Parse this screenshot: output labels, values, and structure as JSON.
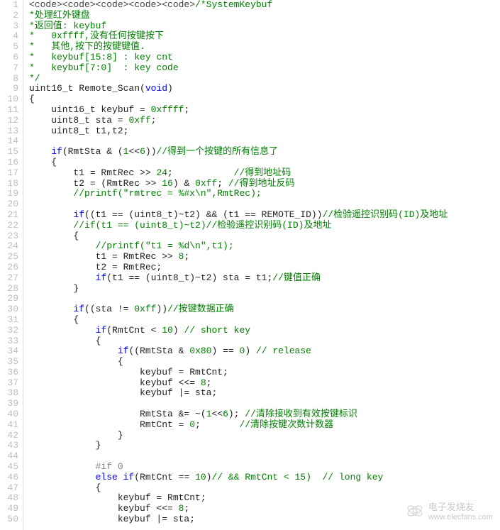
{
  "watermark": {
    "cn": "电子发烧友",
    "url": "www.elecfans.com"
  },
  "lines": [
    {
      "n": 1,
      "type": "mixed",
      "segments": [
        {
          "cls": "c-tag",
          "text": "<code><code><code><code><code>"
        },
        {
          "cls": "c-comment",
          "text": "/*SystemKeybuf"
        }
      ]
    },
    {
      "n": 2,
      "type": "comment",
      "text": "*处理红外键盘"
    },
    {
      "n": 3,
      "type": "comment",
      "text": "*返回值: keybuf"
    },
    {
      "n": 4,
      "type": "comment",
      "text": "*   0xffff,没有任何按键按下"
    },
    {
      "n": 5,
      "type": "comment",
      "text": "*   其他,按下的按键键值."
    },
    {
      "n": 6,
      "type": "comment",
      "text": "*   keybuf[15:8] : key cnt"
    },
    {
      "n": 7,
      "type": "comment",
      "text": "*   keybuf[7:0]  : key code"
    },
    {
      "n": 8,
      "type": "comment",
      "text": "*/"
    },
    {
      "n": 9,
      "type": "code",
      "segments": [
        {
          "cls": "c-default",
          "text": "uint16_t Remote_Scan("
        },
        {
          "cls": "c-keyword",
          "text": "void"
        },
        {
          "cls": "c-default",
          "text": ")"
        }
      ]
    },
    {
      "n": 10,
      "type": "code",
      "segments": [
        {
          "cls": "c-default",
          "text": "{"
        }
      ]
    },
    {
      "n": 11,
      "type": "code",
      "segments": [
        {
          "cls": "c-default",
          "text": "    uint16_t keybuf = "
        },
        {
          "cls": "c-number",
          "text": "0xffff"
        },
        {
          "cls": "c-default",
          "text": ";"
        }
      ]
    },
    {
      "n": 12,
      "type": "code",
      "segments": [
        {
          "cls": "c-default",
          "text": "    uint8_t sta = "
        },
        {
          "cls": "c-number",
          "text": "0xff"
        },
        {
          "cls": "c-default",
          "text": ";"
        }
      ]
    },
    {
      "n": 13,
      "type": "code",
      "segments": [
        {
          "cls": "c-default",
          "text": "    uint8_t t1,t2;"
        }
      ]
    },
    {
      "n": 14,
      "type": "blank"
    },
    {
      "n": 15,
      "type": "code",
      "segments": [
        {
          "cls": "c-default",
          "text": "    "
        },
        {
          "cls": "c-keyword",
          "text": "if"
        },
        {
          "cls": "c-default",
          "text": "(RmtSta & ("
        },
        {
          "cls": "c-number",
          "text": "1"
        },
        {
          "cls": "c-default",
          "text": "<<"
        },
        {
          "cls": "c-number",
          "text": "6"
        },
        {
          "cls": "c-default",
          "text": "))"
        },
        {
          "cls": "c-comment",
          "text": "//得到一个按键的所有信息了"
        }
      ]
    },
    {
      "n": 16,
      "type": "code",
      "segments": [
        {
          "cls": "c-default",
          "text": "    {"
        }
      ]
    },
    {
      "n": 17,
      "type": "code",
      "segments": [
        {
          "cls": "c-default",
          "text": "        t1 = RmtRec >> "
        },
        {
          "cls": "c-number",
          "text": "24"
        },
        {
          "cls": "c-default",
          "text": ";           "
        },
        {
          "cls": "c-comment",
          "text": "//得到地址码"
        }
      ]
    },
    {
      "n": 18,
      "type": "code",
      "segments": [
        {
          "cls": "c-default",
          "text": "        t2 = (RmtRec >> "
        },
        {
          "cls": "c-number",
          "text": "16"
        },
        {
          "cls": "c-default",
          "text": ") & "
        },
        {
          "cls": "c-number",
          "text": "0xff"
        },
        {
          "cls": "c-default",
          "text": "; "
        },
        {
          "cls": "c-comment",
          "text": "//得到地址反码"
        }
      ]
    },
    {
      "n": 19,
      "type": "code",
      "segments": [
        {
          "cls": "c-default",
          "text": "        "
        },
        {
          "cls": "c-comment",
          "text": "//printf(\"rmtrec = %#x\\n\",RmtRec);"
        }
      ]
    },
    {
      "n": 20,
      "type": "blank"
    },
    {
      "n": 21,
      "type": "code",
      "segments": [
        {
          "cls": "c-default",
          "text": "        "
        },
        {
          "cls": "c-keyword",
          "text": "if"
        },
        {
          "cls": "c-default",
          "text": "((t1 == (uint8_t)~t2) && (t1 == REMOTE_ID))"
        },
        {
          "cls": "c-comment",
          "text": "//检验遥控识别码(ID)及地址"
        }
      ]
    },
    {
      "n": 22,
      "type": "code",
      "segments": [
        {
          "cls": "c-default",
          "text": "        "
        },
        {
          "cls": "c-comment",
          "text": "//if(t1 == (uint8_t)~t2)//检验遥控识别码(ID)及地址"
        }
      ]
    },
    {
      "n": 23,
      "type": "code",
      "segments": [
        {
          "cls": "c-default",
          "text": "        {"
        }
      ]
    },
    {
      "n": 24,
      "type": "code",
      "segments": [
        {
          "cls": "c-default",
          "text": "            "
        },
        {
          "cls": "c-comment",
          "text": "//printf(\"t1 = %d\\n\",t1);"
        }
      ]
    },
    {
      "n": 25,
      "type": "code",
      "segments": [
        {
          "cls": "c-default",
          "text": "            t1 = RmtRec >> "
        },
        {
          "cls": "c-number",
          "text": "8"
        },
        {
          "cls": "c-default",
          "text": ";"
        }
      ]
    },
    {
      "n": 26,
      "type": "code",
      "segments": [
        {
          "cls": "c-default",
          "text": "            t2 = RmtRec;"
        }
      ]
    },
    {
      "n": 27,
      "type": "code",
      "segments": [
        {
          "cls": "c-default",
          "text": "            "
        },
        {
          "cls": "c-keyword",
          "text": "if"
        },
        {
          "cls": "c-default",
          "text": "(t1 == (uint8_t)~t2) sta = t1;"
        },
        {
          "cls": "c-comment",
          "text": "//键值正确"
        }
      ]
    },
    {
      "n": 28,
      "type": "code",
      "segments": [
        {
          "cls": "c-default",
          "text": "        }"
        }
      ]
    },
    {
      "n": 29,
      "type": "blank"
    },
    {
      "n": 30,
      "type": "code",
      "segments": [
        {
          "cls": "c-default",
          "text": "        "
        },
        {
          "cls": "c-keyword",
          "text": "if"
        },
        {
          "cls": "c-default",
          "text": "((sta != "
        },
        {
          "cls": "c-number",
          "text": "0xff"
        },
        {
          "cls": "c-default",
          "text": "))"
        },
        {
          "cls": "c-comment",
          "text": "//按键数据正确"
        }
      ]
    },
    {
      "n": 31,
      "type": "code",
      "segments": [
        {
          "cls": "c-default",
          "text": "        {"
        }
      ]
    },
    {
      "n": 32,
      "type": "code",
      "segments": [
        {
          "cls": "c-default",
          "text": "            "
        },
        {
          "cls": "c-keyword",
          "text": "if"
        },
        {
          "cls": "c-default",
          "text": "(RmtCnt < "
        },
        {
          "cls": "c-number",
          "text": "10"
        },
        {
          "cls": "c-default",
          "text": ") "
        },
        {
          "cls": "c-comment",
          "text": "// short key"
        }
      ]
    },
    {
      "n": 33,
      "type": "code",
      "segments": [
        {
          "cls": "c-default",
          "text": "            {"
        }
      ]
    },
    {
      "n": 34,
      "type": "code",
      "segments": [
        {
          "cls": "c-default",
          "text": "                "
        },
        {
          "cls": "c-keyword",
          "text": "if"
        },
        {
          "cls": "c-default",
          "text": "((RmtSta & "
        },
        {
          "cls": "c-number",
          "text": "0x80"
        },
        {
          "cls": "c-default",
          "text": ") == "
        },
        {
          "cls": "c-number",
          "text": "0"
        },
        {
          "cls": "c-default",
          "text": ") "
        },
        {
          "cls": "c-comment",
          "text": "// release"
        }
      ]
    },
    {
      "n": 35,
      "type": "code",
      "segments": [
        {
          "cls": "c-default",
          "text": "                {"
        }
      ]
    },
    {
      "n": 36,
      "type": "code",
      "segments": [
        {
          "cls": "c-default",
          "text": "                    keybuf = RmtCnt;"
        }
      ]
    },
    {
      "n": 37,
      "type": "code",
      "segments": [
        {
          "cls": "c-default",
          "text": "                    keybuf <<= "
        },
        {
          "cls": "c-number",
          "text": "8"
        },
        {
          "cls": "c-default",
          "text": ";"
        }
      ]
    },
    {
      "n": 38,
      "type": "code",
      "segments": [
        {
          "cls": "c-default",
          "text": "                    keybuf |= sta;"
        }
      ]
    },
    {
      "n": 39,
      "type": "blank"
    },
    {
      "n": 40,
      "type": "code",
      "segments": [
        {
          "cls": "c-default",
          "text": "                    RmtSta &= ~("
        },
        {
          "cls": "c-number",
          "text": "1"
        },
        {
          "cls": "c-default",
          "text": "<<"
        },
        {
          "cls": "c-number",
          "text": "6"
        },
        {
          "cls": "c-default",
          "text": "); "
        },
        {
          "cls": "c-comment",
          "text": "//清除接收到有效按键标识"
        }
      ]
    },
    {
      "n": 41,
      "type": "code",
      "segments": [
        {
          "cls": "c-default",
          "text": "                    RmtCnt = "
        },
        {
          "cls": "c-number",
          "text": "0"
        },
        {
          "cls": "c-default",
          "text": ";       "
        },
        {
          "cls": "c-comment",
          "text": "//清除按键次数计数器"
        }
      ]
    },
    {
      "n": 42,
      "type": "code",
      "segments": [
        {
          "cls": "c-default",
          "text": "                }"
        }
      ]
    },
    {
      "n": 43,
      "type": "code",
      "segments": [
        {
          "cls": "c-default",
          "text": "            }"
        }
      ]
    },
    {
      "n": 44,
      "type": "blank"
    },
    {
      "n": 45,
      "type": "code",
      "segments": [
        {
          "cls": "c-default",
          "text": "            "
        },
        {
          "cls": "c-preproc",
          "text": "#if 0"
        }
      ]
    },
    {
      "n": 46,
      "type": "code",
      "segments": [
        {
          "cls": "c-default",
          "text": "            "
        },
        {
          "cls": "c-keyword",
          "text": "else if"
        },
        {
          "cls": "c-default",
          "text": "(RmtCnt == "
        },
        {
          "cls": "c-number",
          "text": "10"
        },
        {
          "cls": "c-default",
          "text": ")"
        },
        {
          "cls": "c-comment",
          "text": "// && RmtCnt < 15)  // long key"
        }
      ]
    },
    {
      "n": 47,
      "type": "code",
      "segments": [
        {
          "cls": "c-default",
          "text": "            {"
        }
      ]
    },
    {
      "n": 48,
      "type": "code",
      "segments": [
        {
          "cls": "c-default",
          "text": "                keybuf = RmtCnt;"
        }
      ]
    },
    {
      "n": 49,
      "type": "code",
      "segments": [
        {
          "cls": "c-default",
          "text": "                keybuf <<= "
        },
        {
          "cls": "c-number",
          "text": "8"
        },
        {
          "cls": "c-default",
          "text": ";"
        }
      ]
    },
    {
      "n": 50,
      "type": "code",
      "segments": [
        {
          "cls": "c-default",
          "text": "                keybuf |= sta;"
        }
      ]
    }
  ]
}
